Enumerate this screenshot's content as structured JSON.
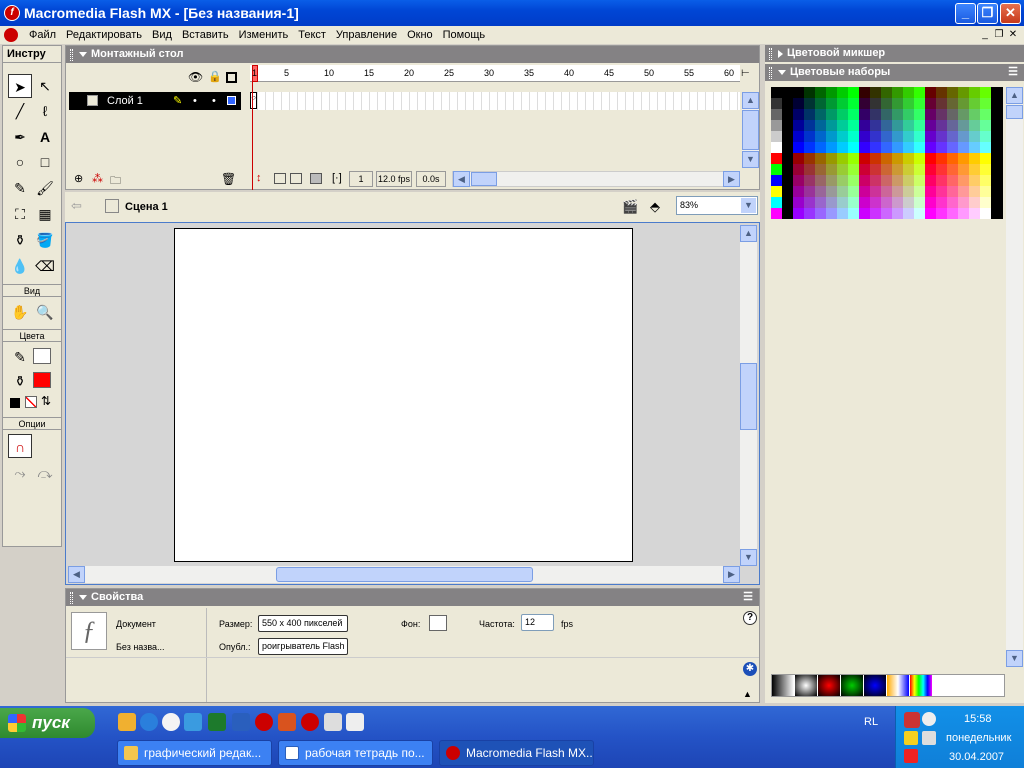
{
  "window": {
    "title": "Macromedia Flash MX - [Без названия-1]"
  },
  "titlebar_buttons": {
    "minimize": "_",
    "maximize": "❐",
    "close": "✕"
  },
  "menu": [
    "Файл",
    "Редактировать",
    "Вид",
    "Вставить",
    "Изменить",
    "Текст",
    "Управление",
    "Окно",
    "Помощь"
  ],
  "mdi_buttons": {
    "minimize": "_",
    "restore": "❐",
    "close": "✕"
  },
  "toolbox": {
    "title": "Инстру",
    "view_label": "Вид",
    "colors_label": "Цвета",
    "options_label": "Опции"
  },
  "timeline": {
    "title": "Монтажный стол",
    "frame_numbers": [
      "1",
      "5",
      "10",
      "15",
      "20",
      "25",
      "30",
      "35",
      "40",
      "45",
      "50",
      "55",
      "60"
    ],
    "layer_name": "Слой 1",
    "current_frame": "1",
    "fps": "12.0 fps",
    "time": "0.0s"
  },
  "editbar": {
    "scene": "Сцена 1",
    "zoom": "83%"
  },
  "properties": {
    "title": "Свойства",
    "doc_type": "Документ",
    "doc_name": "Без назва...",
    "size_label": "Размер:",
    "size_value": "550 x 400 пикселей",
    "publish_label": "Опубл.:",
    "publish_value": "роигрыватель Flash",
    "bg_label": "Фон:",
    "rate_label": "Частота:",
    "rate_value": "12",
    "fps_unit": "fps",
    "help_glyph": "?"
  },
  "right": {
    "mixer_title": "Цветовой микшер",
    "swatches_title": "Цветовые наборы"
  },
  "colors": {
    "stroke": "#000000",
    "fill": "#ff0000",
    "accent": "#0046d5"
  },
  "taskbar": {
    "start": "пуск",
    "items": [
      "графический редак...",
      "рабочая тетрадь по...",
      "Macromedia Flash MX..."
    ],
    "lang": "RL",
    "time": "15:58",
    "day": "понедельник",
    "date": "30.04.2007"
  }
}
